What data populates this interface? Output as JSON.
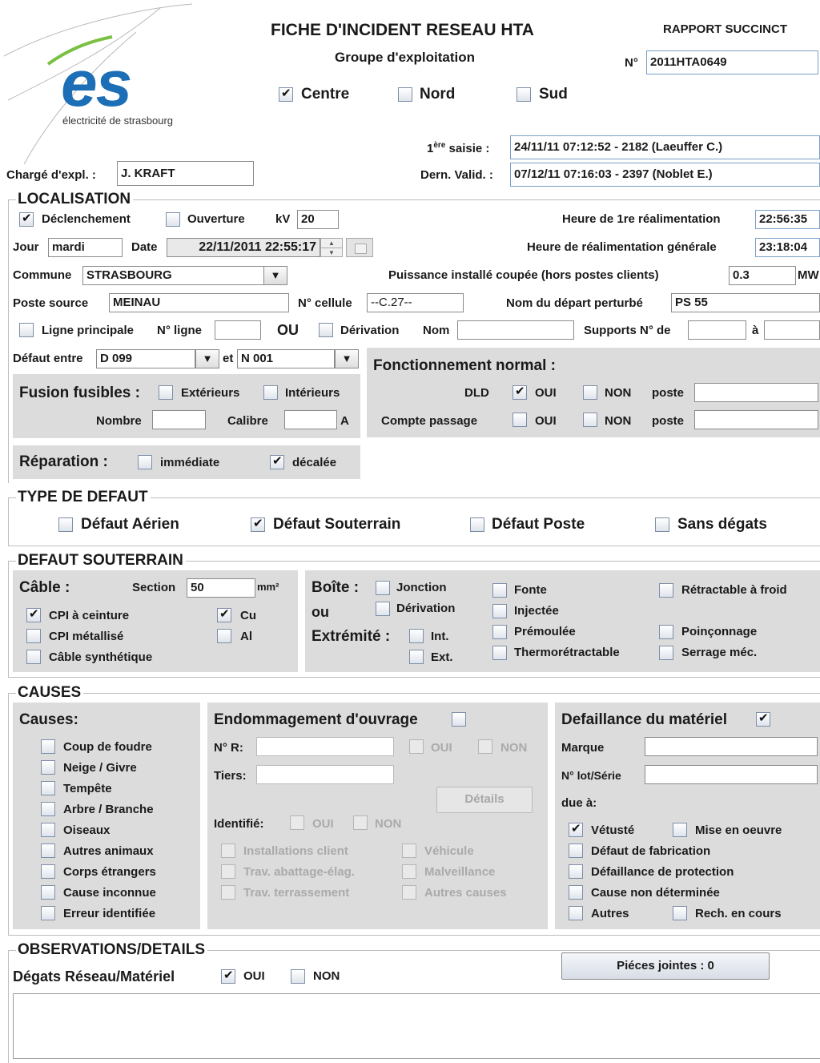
{
  "header": {
    "logo_text": "es",
    "logo_caption": "électricité de strasbourg",
    "title": "FICHE D'INCIDENT RESEAU HTA",
    "subtitle": "Groupe d'exploitation",
    "report_type": "RAPPORT SUCCINCT",
    "number_label": "N°",
    "number_value": "2011HTA0649",
    "groups": [
      {
        "label": "Centre",
        "checked": true
      },
      {
        "label": "Nord",
        "checked": false
      },
      {
        "label": "Sud",
        "checked": false
      }
    ],
    "first_entry_label_sup": "ère",
    "first_entry_label_pre": "1",
    "first_entry_label_post": " saisie :",
    "first_entry_value": "24/11/11 07:12:52 - 2182 (Laeuffer C.)",
    "last_valid_label": "Dern. Valid. :",
    "last_valid_value": "07/12/11 07:16:03 - 2397 (Noblet E.)",
    "charge_label": "Chargé d'expl. :",
    "charge_value": "J. KRAFT"
  },
  "localisation": {
    "title": "LOCALISATION",
    "declenchement": {
      "label": "Déclenchement",
      "checked": true
    },
    "ouverture": {
      "label": "Ouverture",
      "checked": false
    },
    "kv_label": "kV",
    "kv_value": "20",
    "first_realim_label": "Heure de 1re réalimentation",
    "first_realim_value": "22:56:35",
    "jour_label": "Jour",
    "jour_value": "mardi",
    "date_label": "Date",
    "date_value": "22/11/2011 22:55:17",
    "general_realim_label": "Heure de réalimentation générale",
    "general_realim_value": "23:18:04",
    "commune_label": "Commune",
    "commune_value": "STRASBOURG",
    "puissance_label": "Puissance installé coupée (hors postes clients)",
    "puissance_value": "0.3",
    "puissance_unit": "MW",
    "poste_source_label": "Poste source",
    "poste_source_value": "MEINAU",
    "cellule_label": "N° cellule",
    "cellule_value": "--C.27--",
    "depart_label": "Nom du départ perturbé",
    "depart_value": "PS 55",
    "ligne_principale_label": "Ligne principale",
    "n_ligne_label": "N° ligne",
    "ou_label": "OU",
    "derivation_label": "Dérivation",
    "nom_label": "Nom",
    "supports_label": "Supports N° de",
    "a_label": "à",
    "defaut_entre_label": "Défaut entre",
    "defaut_from": "D 099",
    "et_label": "et",
    "defaut_to": "N 001",
    "fusion_label": "Fusion fusibles :",
    "exterieurs_label": "Extérieurs",
    "interieurs_label": "Intérieurs",
    "nombre_label": "Nombre",
    "calibre_label": "Calibre",
    "calibre_unit": "A",
    "reparation_label": "Réparation :",
    "immediate_label": "immédiate",
    "decalee_label": "décalée",
    "fonct_title": "Fonctionnement normal :",
    "dld_label": "DLD",
    "compte_label": "Compte passage",
    "oui_label": "OUI",
    "non_label": "NON",
    "poste_label": "poste"
  },
  "type_defaut": {
    "title": "TYPE DE DEFAUT",
    "items": [
      {
        "label": "Défaut Aérien",
        "checked": false
      },
      {
        "label": "Défaut Souterrain",
        "checked": true
      },
      {
        "label": "Défaut Poste",
        "checked": false
      },
      {
        "label": "Sans dégats",
        "checked": false
      }
    ]
  },
  "souterrain": {
    "title": "DEFAUT SOUTERRAIN",
    "cable_label": "Câble :",
    "section_label": "Section",
    "section_value": "50",
    "section_unit": "mm²",
    "cpi_ceinture": "CPI à ceinture",
    "cpi_metal": "CPI métallisé",
    "cable_synth": "Câble synthétique",
    "cu": "Cu",
    "al": "Al",
    "boite_label": "Boîte :",
    "ou_label": "ou",
    "extremite_label": "Extrémité :",
    "jonction": "Jonction",
    "derivation": "Dérivation",
    "int": "Int.",
    "ext": "Ext.",
    "fonte": "Fonte",
    "injectee": "Injectée",
    "premoulee": "Prémoulée",
    "thermo": "Thermorétractable",
    "retract_froid": "Rétractable à froid",
    "poinconnage": "Poinçonnage",
    "serrage": "Serrage méc."
  },
  "causes": {
    "title": "CAUSES",
    "causes_label": "Causes:",
    "list": [
      "Coup de foudre",
      "Neige / Givre",
      "Tempête",
      "Arbre / Branche",
      "Oiseaux",
      "Autres animaux",
      "Corps étrangers",
      "Cause inconnue",
      "Erreur identifiée"
    ],
    "endommagement_label": "Endommagement d'ouvrage",
    "nr_label": "N° R:",
    "tiers_label": "Tiers:",
    "oui_label": "OUI",
    "non_label": "NON",
    "details_label": "Détails",
    "identifie_label": "Identifié:",
    "end_left": [
      "Installations client",
      "Trav. abattage-élag.",
      "Trav. terrassement"
    ],
    "end_right": [
      "Véhicule",
      "Malveillance",
      "Autres causes"
    ],
    "defaillance_label": "Defaillance du matériel",
    "marque_label": "Marque",
    "lot_label": "N° lot/Série",
    "due_label": "due à:",
    "vetuste": "Vétusté",
    "mise_oeuvre": "Mise en oeuvre",
    "defaut_fab": "Défaut de fabrication",
    "defaillance_prot": "Défaillance de protection",
    "cause_nd": "Cause non déterminée",
    "autres": "Autres",
    "rech": "Rech. en cours"
  },
  "observations": {
    "title": "OBSERVATIONS/DETAILS",
    "degats_label": "Dégats Réseau/Matériel",
    "oui_label": "OUI",
    "non_label": "NON",
    "pieces_label": "Piéces jointes : 0"
  },
  "colors": {
    "logo_blue": "#1c6fb6",
    "logo_green": "#7ac143",
    "panel_gray": "#dcdcdc"
  }
}
